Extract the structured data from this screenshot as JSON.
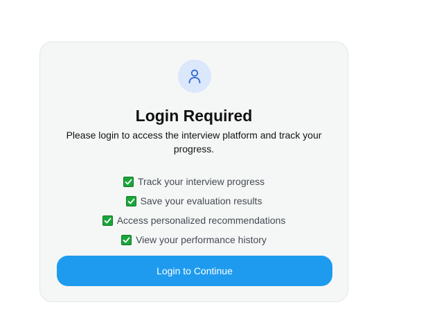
{
  "card": {
    "icon": "user-icon",
    "title": "Login Required",
    "subtitle": "Please login to access the interview platform and track your progress.",
    "features": [
      {
        "icon": "checkmark-icon",
        "label": "Track your interview progress"
      },
      {
        "icon": "checkmark-icon",
        "label": "Save your evaluation results"
      },
      {
        "icon": "checkmark-icon",
        "label": "Access personalized recommendations"
      },
      {
        "icon": "checkmark-icon",
        "label": "View your performance history"
      }
    ],
    "button_label": "Login to Continue"
  },
  "colors": {
    "accent": "#1e9bef",
    "avatar_bg": "#dbe7fb",
    "avatar_icon": "#2b63d9",
    "check": "#1aa53a",
    "card_bg": "#f5f7f7"
  }
}
